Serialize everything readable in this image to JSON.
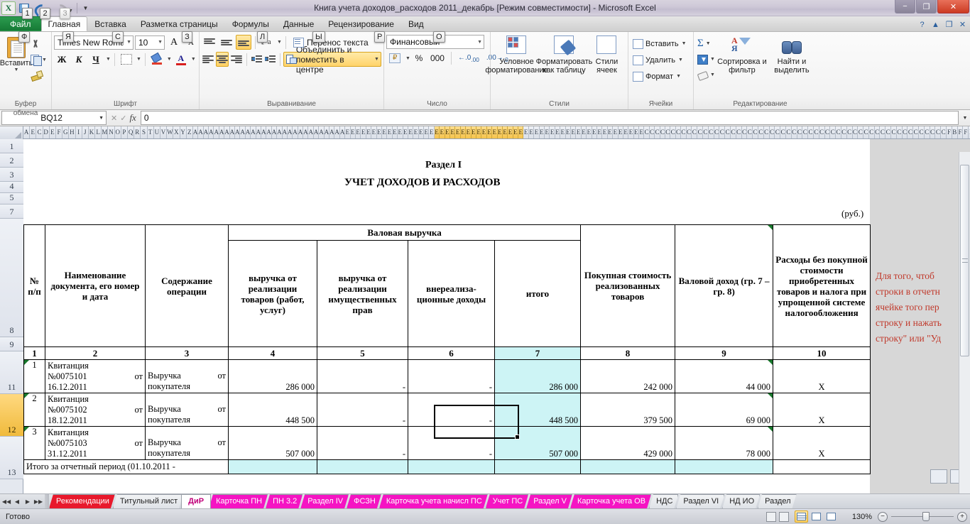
{
  "window": {
    "title": "Книга учета доходов_расходов 2011_декабрь  [Режим совместимости]  -  Microsoft Excel",
    "minimize": "−",
    "maximize": "❐",
    "close": "✕"
  },
  "quick_access": {
    "save_keytip": "1",
    "undo_keytip": "2",
    "redo_keytip": "3"
  },
  "ribbon": {
    "tabs": [
      {
        "label": "Файл",
        "keytip": "Ф"
      },
      {
        "label": "Главная",
        "keytip": "Я"
      },
      {
        "label": "Вставка",
        "keytip": "С"
      },
      {
        "label": "Разметка страницы",
        "keytip": "З"
      },
      {
        "label": "Формулы",
        "keytip": "Л"
      },
      {
        "label": "Данные",
        "keytip": "Ы"
      },
      {
        "label": "Рецензирование",
        "keytip": "Р"
      },
      {
        "label": "Вид",
        "keytip": "О"
      }
    ],
    "groups": {
      "clipboard": {
        "name": "Буфер обмена",
        "paste_label": "Вставить",
        "cut_icon": "scissors-icon",
        "copy_icon": "copy-icon",
        "format_painter_icon": "format-painter-icon"
      },
      "font": {
        "name": "Шрифт",
        "font_name": "Times New Roman",
        "font_size": "10",
        "grow_font": "A",
        "shrink_font": "A",
        "bold": "Ж",
        "italic": "К",
        "underline": "Ч",
        "borders_icon": "borders-icon",
        "fill_color_icon": "fill-color-icon",
        "font_color_icon": "font-color-icon",
        "font_color_letter": "A"
      },
      "alignment": {
        "name": "Выравнивание",
        "wrap_text": "Перенос текста",
        "merge_center": "Объединить и поместить в центре",
        "orientation_icon": "orientation-icon",
        "decrease_indent_icon": "decrease-indent-icon",
        "increase_indent_icon": "increase-indent-icon"
      },
      "number": {
        "name": "Число",
        "format": "Финансовый",
        "currency_icon": "currency-icon",
        "percent": "%",
        "thousands": "000",
        "increase_decimal": "増",
        "decrease_decimal": "減"
      },
      "styles": {
        "name": "Стили",
        "conditional": "Условное форматирование",
        "as_table": "Форматировать как таблицу",
        "cell_styles": "Стили ячеек"
      },
      "cells": {
        "name": "Ячейки",
        "insert": "Вставить",
        "delete": "Удалить",
        "format": "Формат"
      },
      "editing": {
        "name": "Редактирование",
        "autosum": "Σ",
        "fill_icon": "fill-down-icon",
        "clear_icon": "eraser-icon",
        "sort_filter": "Сортировка и фильтр",
        "find_select": "Найти и выделить"
      }
    },
    "help_icon": "help-icon",
    "minimize_ribbon_icon": "minimize-ribbon-icon",
    "restore_icon": "restore-icon",
    "close_doc_icon": "close-document-icon"
  },
  "formula_bar": {
    "name_box": "BQ12",
    "cancel_icon": "cancel-icon",
    "enter_icon": "enter-icon",
    "fx_icon": "fx-icon",
    "value": "0",
    "expand_icon": "expand-formula-bar-icon"
  },
  "grid": {
    "row_headers": [
      "1",
      "2",
      "3",
      "4",
      "5",
      "7",
      "8",
      "9",
      "11",
      "12",
      "13"
    ],
    "selected_row": "12",
    "column_letters_run": "AEСDEFGHIJKLMNOPQRSTUVWXYZAAAAAAAAAAAAAAAAAAAAAAAAAAAAAEEEEEEEEEEEEEEEEEEEEEEEEEEEEEEEEEEEEEEEEEEEEEEEEEEEEEEEEECCCCCCCCCCCCCCCCCCCCCCCCCCCCCCCCCCCCCCCCCCCCCCCCCCCCCCC FB FFF",
    "selected_columns_hint": "EEEEEEEEEEEECCCCC"
  },
  "sheet": {
    "title_line1": "Раздел I",
    "title_line2": "УЧЕТ ДОХОДОВ И РАСХОДОВ",
    "units": "(руб.)",
    "table": {
      "group_header": "Валовая выручка",
      "headers": [
        "№ п/п",
        "Наименование документа, его номер и дата",
        "Содержание операции",
        "выручка от реализации товаров (работ, услуг)",
        "выручка от реализации имущественных прав",
        "внереализа-ционные доходы",
        "итого",
        "Покупная стоимость реализованных товаров",
        "Валовой доход (гр. 7 – гр. 8)",
        "Расходы без покупной стоимости приобретенных товаров и налога при упрощенной системе налогообложения"
      ],
      "header_num_row": [
        "1",
        "2",
        "3",
        "4",
        "5",
        "6",
        "7",
        "8",
        "9",
        "10"
      ],
      "rows": [
        {
          "n": "1",
          "doc_name": "Квитанция",
          "doc_number": "№0075101",
          "doc_from": "от",
          "doc_date": "16.12.2011",
          "operation": "Выручка",
          "operation_from": "от",
          "operation_2": "покупателя",
          "revenue_goods": "286 000",
          "revenue_rights": "-",
          "nonsales": "-",
          "total": "286 000",
          "purchase_cost": "242 000",
          "gross_income": "44 000",
          "expenses": "X"
        },
        {
          "n": "2",
          "doc_name": "Квитанция",
          "doc_number": "№0075102",
          "doc_from": "от",
          "doc_date": "18.12.2011",
          "operation": "Выручка",
          "operation_from": "от",
          "operation_2": "покупателя",
          "revenue_goods": "448 500",
          "revenue_rights": "-",
          "nonsales": "-",
          "total": "448 500",
          "purchase_cost": "379 500",
          "gross_income": "69 000",
          "expenses": "X"
        },
        {
          "n": "3",
          "doc_name": "Квитанция",
          "doc_number": "№0075103",
          "doc_from": "от",
          "doc_date": "31.12.2011",
          "operation": "Выручка",
          "operation_from": "от",
          "operation_2": "покупателя",
          "revenue_goods": "507 000",
          "revenue_rights": "-",
          "nonsales": "-",
          "total": "507 000",
          "purchase_cost": "429 000",
          "gross_income": "78 000",
          "expenses": "X"
        }
      ],
      "footer_row": "Итого за отчетный период (01.10.2011 -"
    },
    "note": {
      "lines": [
        "Для того, чтоб",
        "строки в отчетн",
        "ячейке того пер",
        "строку и нажать",
        "строку\" или \"Уд"
      ]
    }
  },
  "sheet_tabs": {
    "nav_first": "◀◀",
    "nav_prev": "◀",
    "nav_next": "▶",
    "nav_last": "▶▶",
    "items": [
      {
        "label": "Рекомендации",
        "style": "red"
      },
      {
        "label": "Титульный лист",
        "style": "plain"
      },
      {
        "label": "ДиР",
        "style": "active"
      },
      {
        "label": "Карточка ПН",
        "style": "magenta"
      },
      {
        "label": "ПН 3.2",
        "style": "magenta"
      },
      {
        "label": "Раздел IV",
        "style": "magenta"
      },
      {
        "label": "ФСЗН",
        "style": "magenta"
      },
      {
        "label": "Карточка учета начисл ПС",
        "style": "magenta"
      },
      {
        "label": "Учет ПС",
        "style": "magenta"
      },
      {
        "label": "Раздел V",
        "style": "magenta"
      },
      {
        "label": "Карточка учета ОВ",
        "style": "magenta"
      },
      {
        "label": "НДС",
        "style": "plain"
      },
      {
        "label": "Раздел VI",
        "style": "plain"
      },
      {
        "label": "НД ИО",
        "style": "plain"
      },
      {
        "label": "Раздел",
        "style": "plain"
      }
    ]
  },
  "status_bar": {
    "mode": "Готово",
    "view_normal_icon": "normal-view-icon",
    "view_layout_icon": "page-layout-view-icon",
    "view_break_icon": "page-break-view-icon",
    "zoom": "130%",
    "zoom_out": "−",
    "zoom_in": "+"
  }
}
